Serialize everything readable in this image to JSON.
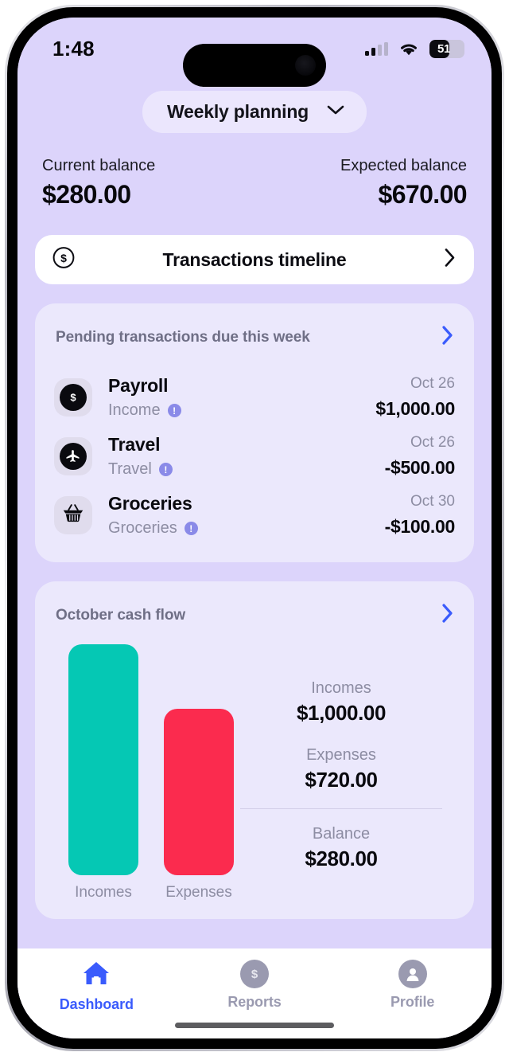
{
  "status_bar": {
    "time": "1:48",
    "battery_level": "51",
    "signal_icon": "cellular-signal-icon",
    "wifi_icon": "wifi-icon",
    "battery_icon": "battery-icon"
  },
  "header": {
    "plan_selector_label": "Weekly planning",
    "plan_selector_icon": "chevron-down-icon"
  },
  "balances": {
    "current_label": "Current balance",
    "current_value": "$280.00",
    "expected_label": "Expected balance",
    "expected_value": "$670.00"
  },
  "timeline": {
    "label": "Transactions timeline",
    "leading_icon": "dollar-circle-icon",
    "trailing_icon": "chevron-right-icon"
  },
  "pending": {
    "title": "Pending transactions due this week",
    "more_icon": "chevron-right-icon",
    "transactions": [
      {
        "name": "Payroll",
        "category": "Income",
        "date": "Oct 26",
        "amount": "$1,000.00",
        "icon": "dollar-icon",
        "info_badge": "!"
      },
      {
        "name": "Travel",
        "category": "Travel",
        "date": "Oct 26",
        "amount": "-$500.00",
        "icon": "airplane-icon",
        "info_badge": "!"
      },
      {
        "name": "Groceries",
        "category": "Groceries",
        "date": "Oct 30",
        "amount": "-$100.00",
        "icon": "shopping-basket-icon",
        "info_badge": "!"
      }
    ]
  },
  "cash_flow": {
    "title": "October cash flow",
    "more_icon": "chevron-right-icon",
    "stats": [
      {
        "label": "Incomes",
        "value": "$1,000.00"
      },
      {
        "label": "Expenses",
        "value": "$720.00"
      },
      {
        "label": "Balance",
        "value": "$280.00"
      }
    ]
  },
  "chart_data": {
    "type": "bar",
    "title": "October cash flow",
    "categories": [
      "Incomes",
      "Expenses"
    ],
    "values": [
      1000,
      720
    ],
    "value_labels": [
      "$1,000.00",
      "$720.00"
    ],
    "colors": [
      "#05c8b4",
      "#fb2b4e"
    ],
    "xlabel": "",
    "ylabel": "",
    "ylim": [
      0,
      1000
    ],
    "grid": false,
    "legend": false,
    "annotations": [
      {
        "label": "Incomes",
        "value": "$1,000.00"
      },
      {
        "label": "Expenses",
        "value": "$720.00"
      },
      {
        "label": "Balance",
        "value": "$280.00"
      }
    ]
  },
  "bottom_nav": {
    "items": [
      {
        "label": "Dashboard",
        "icon": "home-icon",
        "active": true
      },
      {
        "label": "Reports",
        "icon": "dollar-circle-icon",
        "active": false
      },
      {
        "label": "Profile",
        "icon": "person-icon",
        "active": false
      }
    ]
  },
  "colors": {
    "background": "#dcd4fb",
    "card": "#ebe8fc",
    "accent": "#3a5bfc",
    "income": "#05c8b4",
    "expense": "#fb2b4e",
    "muted": "#8d8da3"
  }
}
